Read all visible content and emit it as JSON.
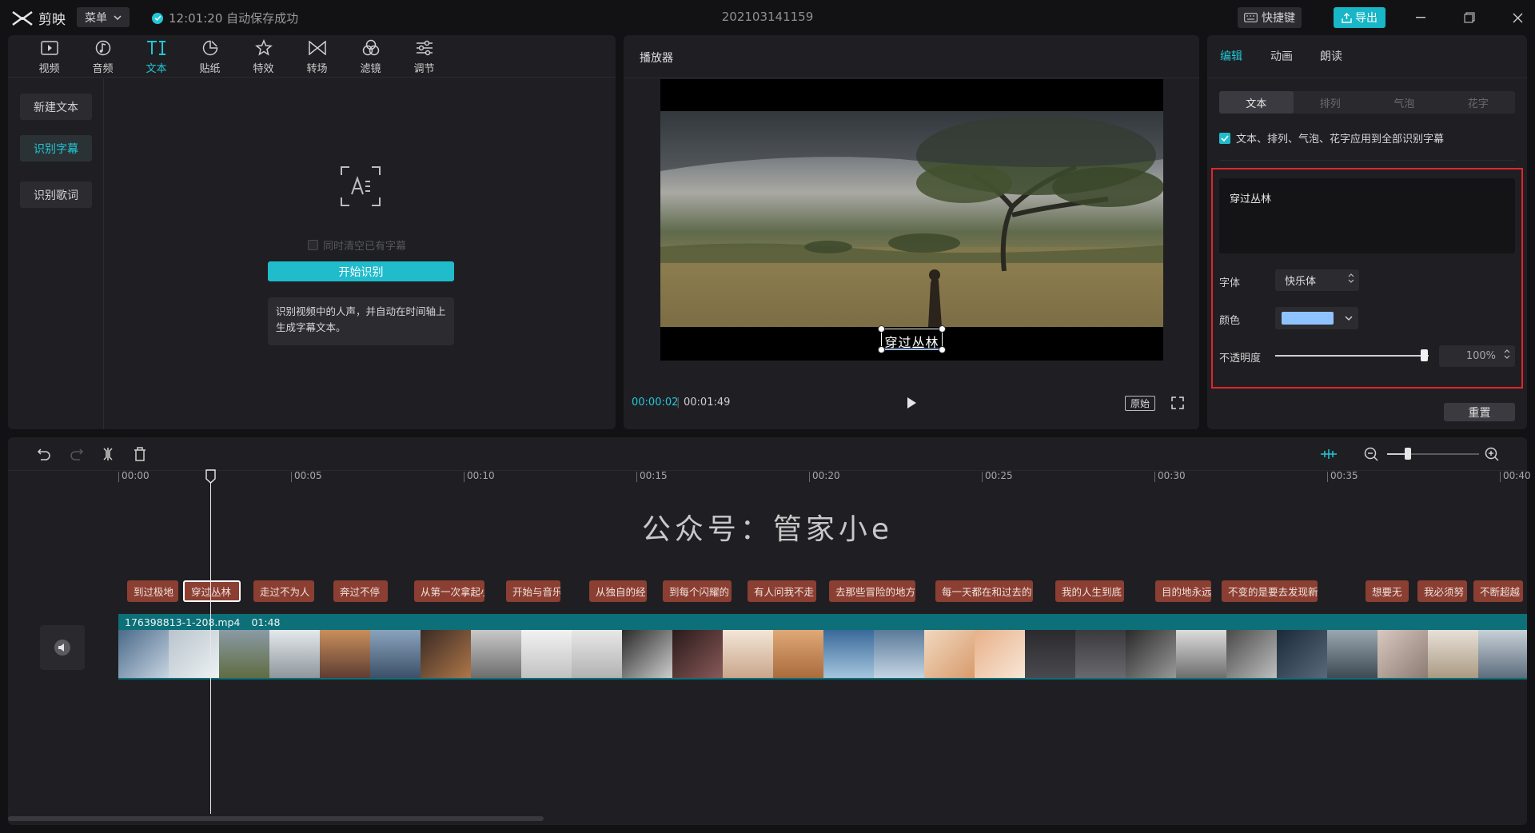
{
  "app": {
    "name": "剪映",
    "menu_label": "菜单",
    "autosave_text": "12:01:20 自动保存成功",
    "project_title": "202103141159",
    "shortcut_label": "快捷键",
    "export_label": "导出"
  },
  "toolbar": {
    "items": [
      {
        "label": "视频",
        "icon": "video-icon"
      },
      {
        "label": "音频",
        "icon": "audio-icon"
      },
      {
        "label": "文本",
        "icon": "text-icon"
      },
      {
        "label": "贴纸",
        "icon": "sticker-icon"
      },
      {
        "label": "特效",
        "icon": "effects-icon"
      },
      {
        "label": "转场",
        "icon": "transition-icon"
      },
      {
        "label": "滤镜",
        "icon": "filter-icon"
      },
      {
        "label": "调节",
        "icon": "adjust-icon"
      }
    ],
    "active_index": 2
  },
  "sidebar": {
    "items": [
      "新建文本",
      "识别字幕",
      "识别歌词"
    ],
    "active_index": 1
  },
  "recognize": {
    "clear_existing_label": "同时清空已有字幕",
    "start_button": "开始识别",
    "hint": "识别视频中的人声，并自动在时间轴上生成字幕文本。"
  },
  "player": {
    "title": "播放器",
    "subtitle_text": "穿过丛林",
    "current_time": "00:00:02",
    "total_time": "00:01:49",
    "ratio_label": "原始"
  },
  "inspector": {
    "tabs": [
      "编辑",
      "动画",
      "朗读"
    ],
    "active_tab": 0,
    "subtabs": [
      "文本",
      "排列",
      "气泡",
      "花字"
    ],
    "active_subtab": 0,
    "apply_all_label": "文本、排列、气泡、花字应用到全部识别字幕",
    "text_value": "穿过丛林",
    "font_label": "字体",
    "font_value": "快乐体",
    "color_label": "颜色",
    "color_value": "#8fc3ff",
    "opacity_label": "不透明度",
    "opacity_value": "100%",
    "reset_label": "重置"
  },
  "timeline": {
    "ruler": [
      "00:00",
      "00:05",
      "00:10",
      "00:15",
      "00:20",
      "00:25",
      "00:30",
      "00:35",
      "00:40"
    ],
    "watermark": "公众号：管家小e",
    "captions": [
      "到过极地",
      "穿过丛林",
      "走过不为人",
      "奔过不停",
      "从第一次拿起小",
      "开始与音乐",
      "从独自的经",
      "到每个闪耀的",
      "有人问我不走",
      "去那些冒险的地方",
      "每一天都在和过去的",
      "我的人生到底",
      "目的地永远",
      "不变的是要去发现新",
      "想要无",
      "我必须努",
      "不断超越"
    ],
    "selected_caption": 1,
    "video_clip_name": "176398813-1-208.mp4",
    "video_clip_duration": "01:48"
  },
  "colors": {
    "accent": "#22c7d6",
    "caption_bg": "#8a3f32",
    "video_track": "#0d6f78",
    "highlight_border": "#e0262b"
  }
}
